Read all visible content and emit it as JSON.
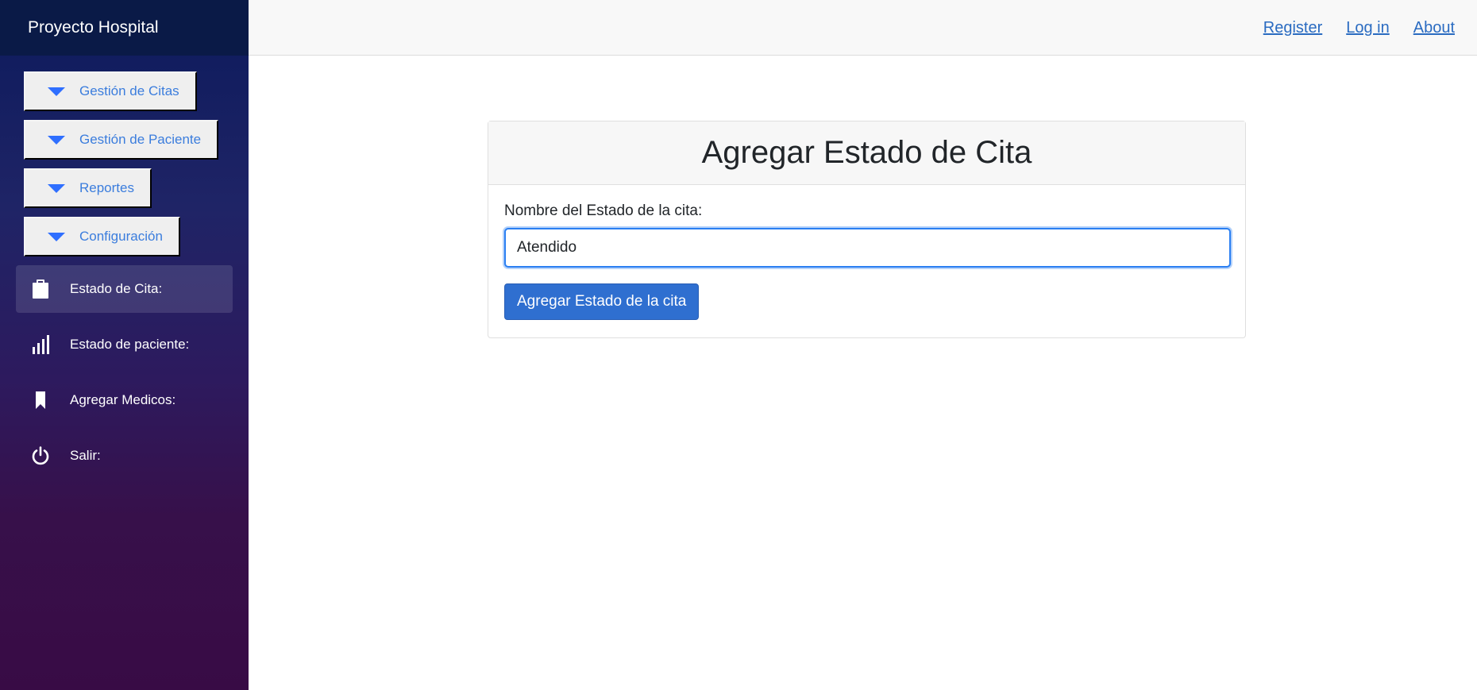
{
  "brand": "Proyecto Hospital",
  "dropdowns": [
    {
      "label": "Gestión de Citas"
    },
    {
      "label": "Gestión de Paciente"
    },
    {
      "label": "Reportes"
    },
    {
      "label": "Configuración"
    }
  ],
  "nav_items": [
    {
      "label": "Estado de Cita:",
      "icon": "clipboard-icon",
      "active": true
    },
    {
      "label": "Estado de paciente:",
      "icon": "bar-chart-icon",
      "active": false
    },
    {
      "label": "Agregar Medicos:",
      "icon": "bookmark-icon",
      "active": false
    },
    {
      "label": "Salir:",
      "icon": "power-icon",
      "active": false
    }
  ],
  "top_links": {
    "register": "Register",
    "login": "Log in",
    "about": "About"
  },
  "form": {
    "title": "Agregar Estado de Cita",
    "field_label": "Nombre del Estado de la cita:",
    "field_value": "Atendido",
    "submit_label": "Agregar Estado de la cita"
  },
  "colors": {
    "accent": "#2f6fd0",
    "link": "#2a6bc1",
    "sidebar_top": "#0c1a5c",
    "sidebar_bottom": "#380b45"
  }
}
